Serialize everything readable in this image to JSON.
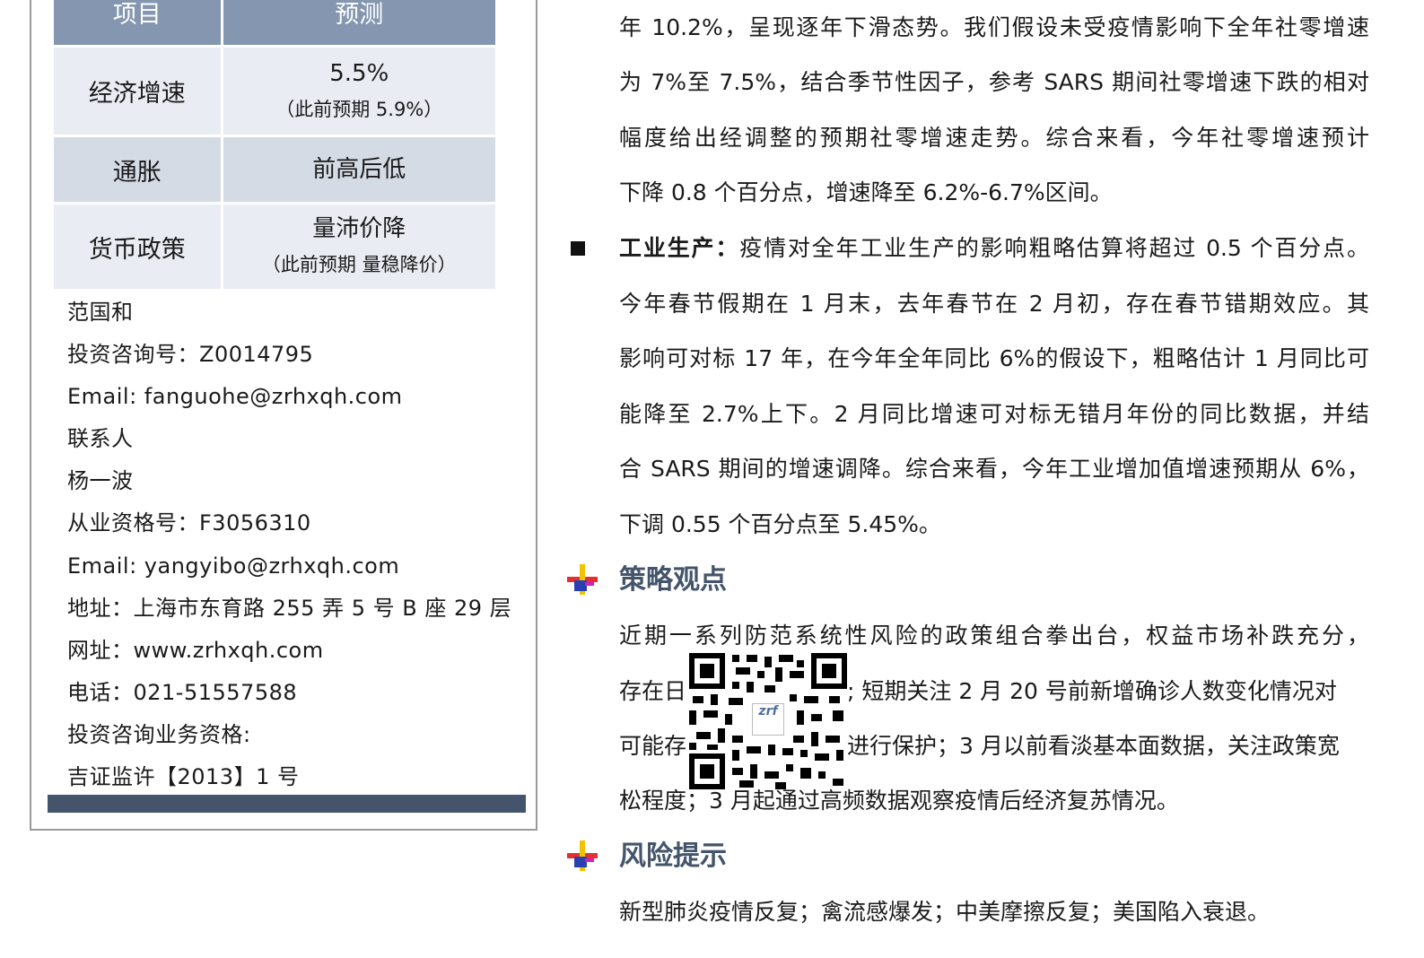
{
  "forecast_table": {
    "headers": [
      "项目",
      "预测"
    ],
    "rows": [
      {
        "item": "经济增速",
        "value": "5.5%",
        "note": "（此前预期 5.9%）"
      },
      {
        "item": "通胀",
        "value": "前高后低",
        "note": ""
      },
      {
        "item": "货币政策",
        "value": "量沛价降",
        "note": "（此前预期 量稳降价）"
      }
    ]
  },
  "contacts": [
    "范国和",
    "投资咨询号：Z0014795",
    "Email: fanguohe@zrhxqh.com",
    "联系人",
    "杨一波",
    "从业资格号：F3056310",
    "Email: yangyibo@zrhxqh.com",
    "地址：上海市东育路 255 弄 5 号 B 座 29 层",
    "网址：www.zrhxqh.com",
    "电话：021-51557588",
    "投资咨询业务资格:",
    "吉证监许【2013】1 号"
  ],
  "consumption_paragraph": [
    "年 10.2%，呈现逐年下滑态势。我们假设未受疫情影响下全年社零增速",
    "为 7%至 7.5%，结合季节性因子，参考 SARS 期间社零增速下跌的相对",
    "幅度给出经调整的预期社零增速走势。综合来看，今年社零增速预计",
    "下降 0.8 个百分点，增速降至 6.2%-6.7%区间。"
  ],
  "industry": {
    "label": "工业生产：",
    "first_line_rest": "疫情对全年工业生产的影响粗略估算将超过 0.5 个百分点。",
    "lines": [
      "今年春节假期在 1 月末，去年春节在 2 月初，存在春节错期效应。其",
      "影响可对标 17 年，在今年全年同比 6%的假设下，粗略估计 1 月同比可",
      "能降至 2.7%上下。2 月同比增速可对标无错月年份的同比数据，并结",
      "合 SARS 期间的增速调降。综合来看，今年工业增加值增速预期从 6%，",
      "下调 0.55 个百分点至 5.45%。"
    ]
  },
  "strategy": {
    "title": "策略观点",
    "lines": [
      "近期一系列防范系统性风险的政策组合拳出台，权益市场补跌充分，",
      "存在日",
      "; 短期关注 2 月 20 号前新增确诊人数变化情况对",
      "可能存",
      "进行保护；3 月以前看淡基本面数据，关注政策宽",
      "松程度；3 月起通过高频数据观察疫情后经济复苏情况。"
    ]
  },
  "risk": {
    "title": "风险提示",
    "text": "新型肺炎疫情反复；禽流感爆发；中美摩擦反复；美国陷入衰退。"
  },
  "qr": {
    "logo_text": "zrf"
  },
  "colors": {
    "header_bg": "#8496b0",
    "row_light": "#e9ecf3",
    "row_dark": "#d5dbe5",
    "heading": "#44546a",
    "bar": "#44546a"
  },
  "icons": [
    "square-bullet-icon",
    "section-cross-icon",
    "qr-code-icon"
  ]
}
